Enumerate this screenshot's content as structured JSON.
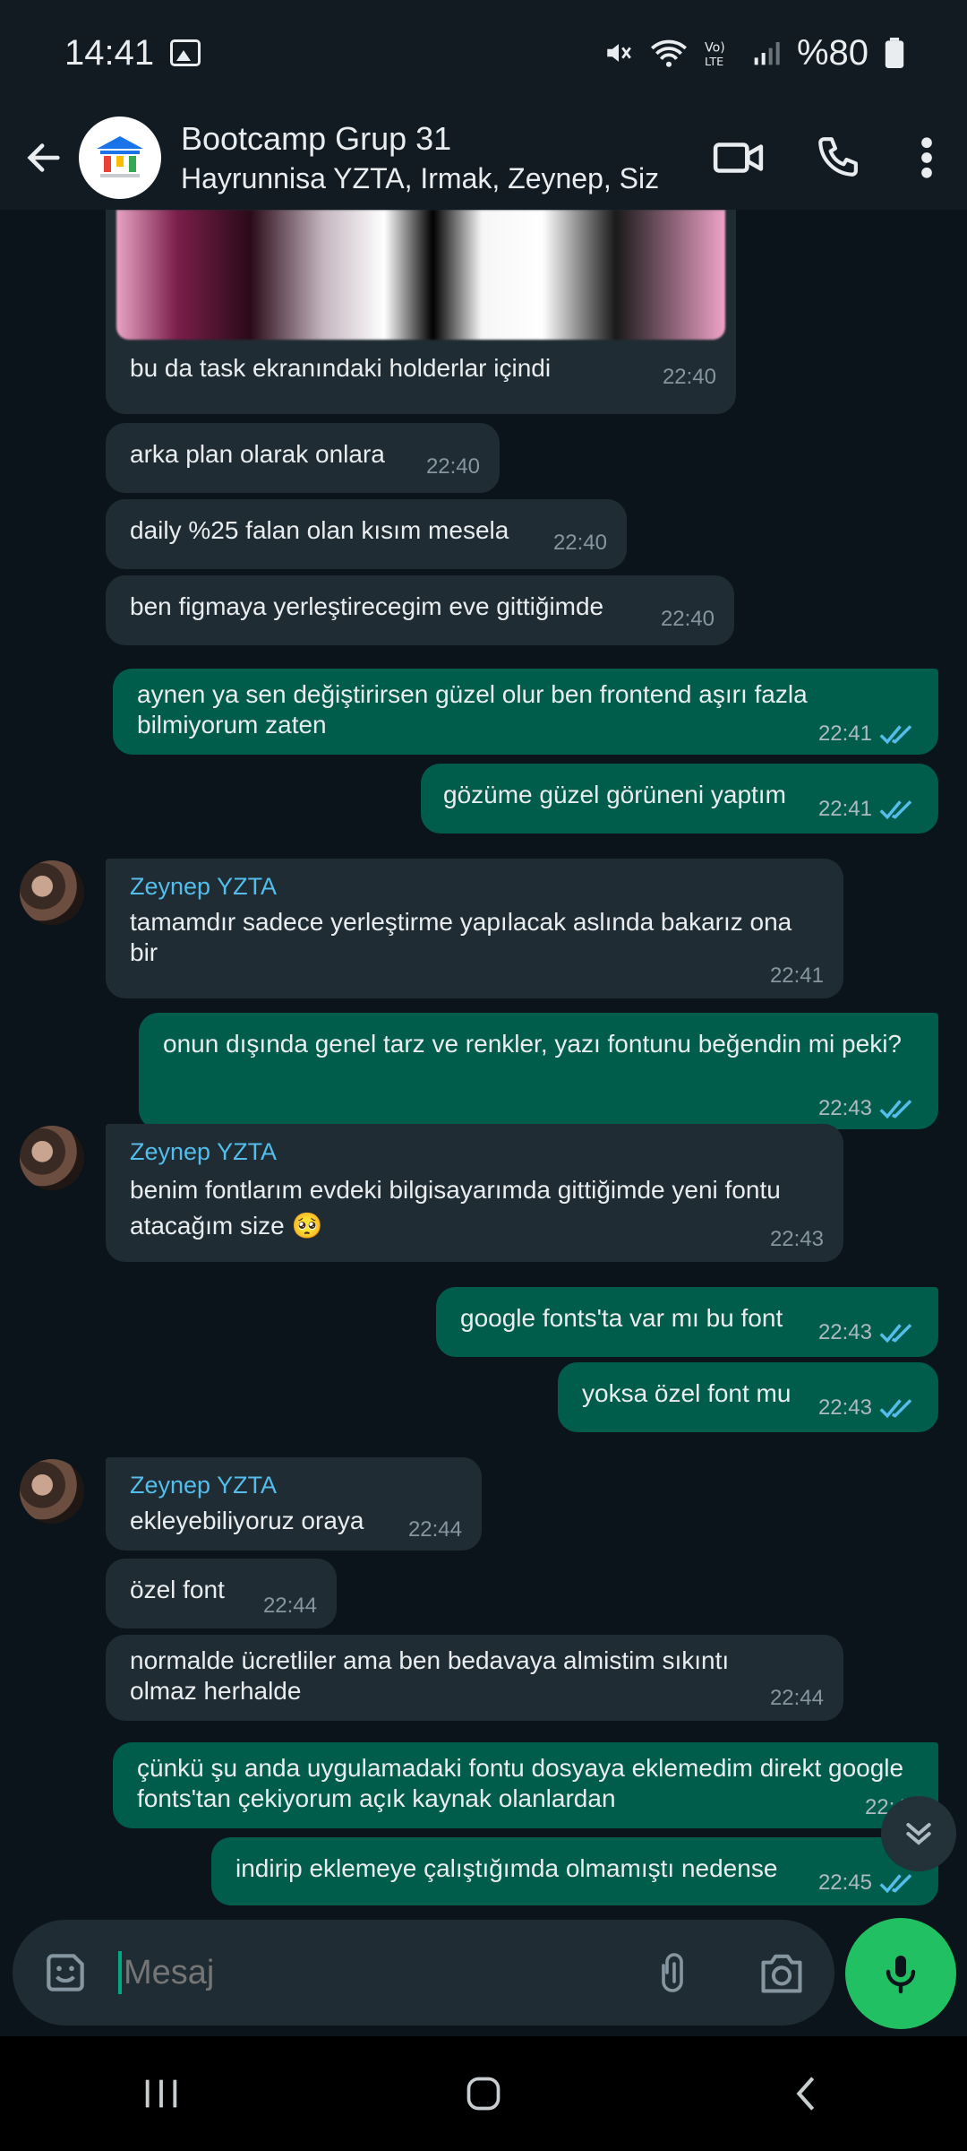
{
  "status_bar": {
    "time": "14:41",
    "battery": "%80"
  },
  "header": {
    "title": "Bootcamp Grup 31",
    "subtitle": "Hayrunnisa YZTA, Irmak, Zeynep, Siz"
  },
  "messages": [
    {
      "dir": "in",
      "text": "bu da task ekranındaki holderlar içindi",
      "time": "22:40"
    },
    {
      "dir": "in",
      "text": "arka plan olarak onlara",
      "time": "22:40"
    },
    {
      "dir": "in",
      "text": "daily %25 falan olan kısım mesela",
      "time": "22:40"
    },
    {
      "dir": "in",
      "text": "ben figmaya yerleştirecegim eve gittiğimde",
      "time": "22:40"
    },
    {
      "dir": "out",
      "text": "aynen ya sen değiştirirsen güzel olur ben frontend aşırı fazla bilmiyorum zaten",
      "time": "22:41"
    },
    {
      "dir": "out",
      "text": "gözüme güzel görüneni yaptım",
      "time": "22:41"
    },
    {
      "dir": "in",
      "sender": "Zeynep YZTA",
      "text": "tamamdır sadece yerleştirme yapılacak aslında bakarız ona bir",
      "time": "22:41"
    },
    {
      "dir": "out",
      "text": "onun dışında genel tarz ve renkler, yazı fontunu beğendin mi peki?",
      "time": "22:43"
    },
    {
      "dir": "in",
      "sender": "Zeynep YZTA",
      "text": "benim fontlarım evdeki bilgisayarımda gittiğimde yeni fontu atacağım size 🥺",
      "time": "22:43"
    },
    {
      "dir": "out",
      "text": "google fonts'ta var mı bu font",
      "time": "22:43"
    },
    {
      "dir": "out",
      "text": "yoksa özel font mu",
      "time": "22:43"
    },
    {
      "dir": "in",
      "sender": "Zeynep YZTA",
      "text": "ekleyebiliyoruz oraya",
      "time": "22:44"
    },
    {
      "dir": "in",
      "text": "özel font",
      "time": "22:44"
    },
    {
      "dir": "in",
      "text": "normalde ücretliler ama ben bedavaya almistim sıkıntı olmaz herhalde",
      "time": "22:44"
    },
    {
      "dir": "out",
      "text": "çünkü şu anda uygulamadaki fontu dosyaya eklemedim direkt google fonts'tan çekiyorum açık kaynak olanlardan",
      "time": "22:45"
    },
    {
      "dir": "out",
      "text": "indirip eklemeye çalıştığımda olmamıştı nedense",
      "time": "22:45"
    }
  ],
  "input": {
    "placeholder": "Mesaj"
  },
  "colors": {
    "tick": "#53bdeb",
    "accent": "#00a884",
    "mic": "#21c063"
  }
}
